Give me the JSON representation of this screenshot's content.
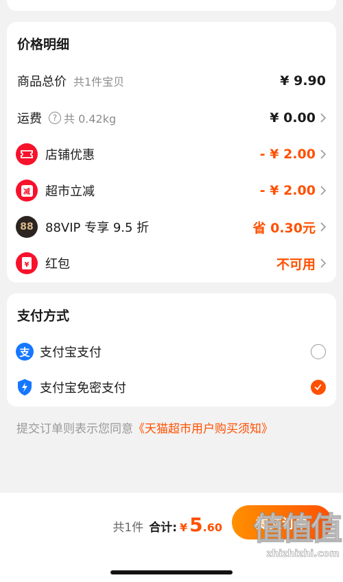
{
  "price_detail": {
    "title": "价格明细",
    "rows": {
      "goods_total": {
        "label": "商品总价",
        "sub": "共1件宝贝",
        "value": "¥ 9.90"
      },
      "shipping": {
        "label": "运费",
        "help": "?",
        "sub": "共 0.42kg",
        "value": "¥ 0.00"
      },
      "shop_discount": {
        "label": "店铺优惠",
        "value": "- ¥ 2.00",
        "icon": "ticket-icon"
      },
      "market_discount": {
        "label": "超市立减",
        "value": "- ¥ 2.00",
        "icon": "market-reduce-icon",
        "icon_char": "减"
      },
      "vip": {
        "label": "88VIP 专享 9.5 折",
        "value": "省 0.30元",
        "icon": "vip88-icon",
        "icon_text": "88"
      },
      "red_packet": {
        "label": "红包",
        "value": "不可用",
        "icon": "red-packet-icon",
        "icon_char": "¥"
      }
    }
  },
  "payment": {
    "title": "支付方式",
    "options": [
      {
        "label": "支付宝支付",
        "icon": "alipay-icon",
        "icon_char": "支",
        "selected": false
      },
      {
        "label": "支付宝免密支付",
        "icon": "alipay-shield-icon",
        "selected": true
      }
    ]
  },
  "agreement": {
    "text": "提交订单则表示您同意",
    "link": "《天猫超市用户购买须知》"
  },
  "footer": {
    "count": "共1件",
    "total_label": "合计:",
    "currency": "¥",
    "amount_int": "5",
    "amount_dec": ".60",
    "submit": "提交订单"
  },
  "watermark": {
    "chars": "值值值",
    "url": "zhizhizhi.com"
  },
  "colors": {
    "accent": "#ff5000",
    "red_icon": "#f7112b",
    "vip_bg": "#2b2420",
    "alipay_blue": "#1677ff"
  }
}
